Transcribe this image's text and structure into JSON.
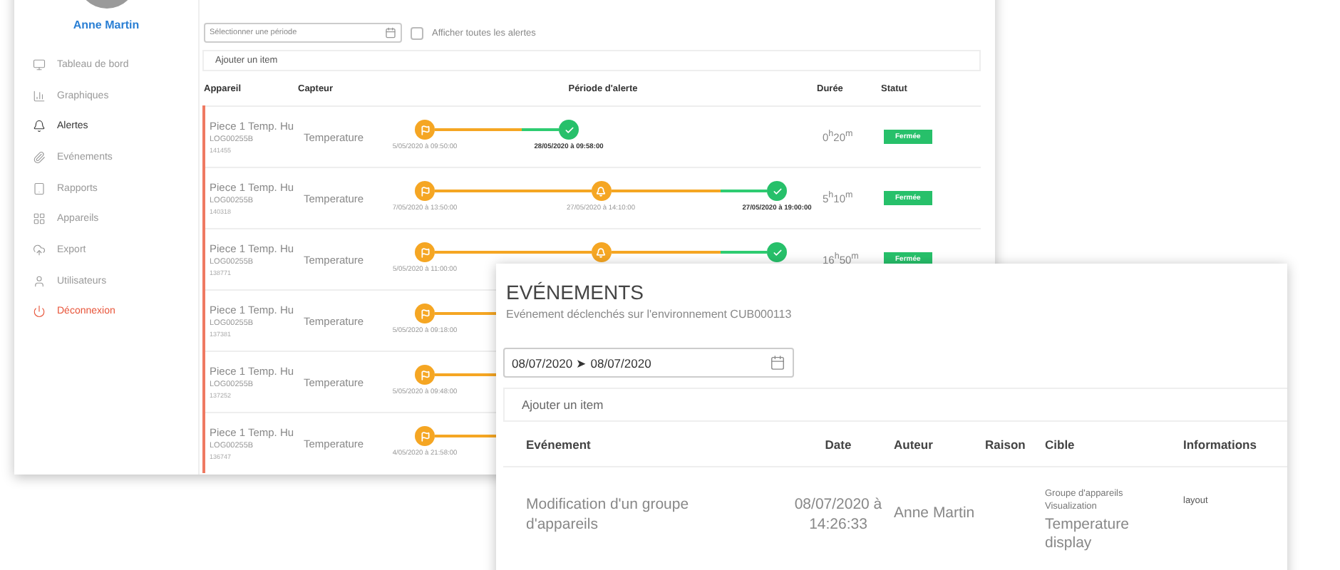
{
  "user": {
    "name": "Anne Martin"
  },
  "sidebar": {
    "items": [
      {
        "label": "Tableau de bord",
        "kind": "link",
        "selected": false
      },
      {
        "label": "Graphiques",
        "kind": "link",
        "selected": false
      },
      {
        "label": "Alertes",
        "kind": "link",
        "selected": true
      },
      {
        "label": "Evénements",
        "kind": "link",
        "selected": false
      },
      {
        "label": "Rapports",
        "kind": "link",
        "selected": false
      },
      {
        "label": "Appareils",
        "kind": "link",
        "selected": false
      },
      {
        "label": "Export",
        "kind": "link",
        "selected": false
      },
      {
        "label": "Utilisateurs",
        "kind": "link",
        "selected": false
      },
      {
        "label": "Déconnexion",
        "kind": "logout",
        "selected": false
      }
    ]
  },
  "alerts": {
    "period_field": {
      "placeholder": "Sélectionner une période"
    },
    "show_all": {
      "label": "Afficher toutes les alertes",
      "checked": false
    },
    "add_item": "Ajouter un item",
    "columns": [
      "Appareil",
      "Capteur",
      "Période d'alerte",
      "Durée",
      "Statut"
    ],
    "rows": [
      {
        "device": "Piece 1 Temp. Hu",
        "logger": "LOG00255B",
        "id": "141455",
        "sensor": "Temperature",
        "events": [
          {
            "kind": "start",
            "time": "5/05/2020 à 09:50:00"
          },
          {
            "kind": "end",
            "time": "28/05/2020 à 09:58:00"
          }
        ],
        "duration": "0$^{h}$20$^{m}$",
        "status": "Fermée"
      },
      {
        "device": "Piece 1 Temp. Hu",
        "logger": "LOG00255B",
        "id": "140318",
        "sensor": "Temperature",
        "events": [
          {
            "kind": "start",
            "time": "7/05/2020 à 13:50:00"
          },
          {
            "kind": "alarm",
            "time": "27/05/2020 à 14:10:00"
          },
          {
            "kind": "end",
            "time": "27/05/2020 à 19:00:00"
          }
        ],
        "duration": "5$^{h}$10$^{m}$",
        "status": "Fermée"
      },
      {
        "device": "Piece 1 Temp. Hu",
        "logger": "LOG00255B",
        "id": "138771",
        "sensor": "Temperature",
        "events": [
          {
            "kind": "start",
            "time": "5/05/2020 à 11:00:00"
          },
          {
            "kind": "alarm"
          },
          {
            "kind": "end"
          }
        ],
        "duration": "16$^{h}$50$^{m}$",
        "status": "Fermée"
      },
      {
        "device": "Piece 1 Temp. Hu",
        "logger": "LOG00255B",
        "id": "137381",
        "sensor": "Temperature",
        "events": [
          {
            "kind": "start",
            "time": "5/05/2020 à 09:18:00"
          }
        ]
      },
      {
        "device": "Piece 1 Temp. Hu",
        "logger": "LOG00255B",
        "id": "137252",
        "sensor": "Temperature",
        "events": [
          {
            "kind": "start",
            "time": "5/05/2020 à 09:48:00"
          }
        ]
      },
      {
        "device": "Piece 1 Temp. Hu",
        "logger": "LOG00255B",
        "id": "136747",
        "sensor": "Temperature",
        "events": [
          {
            "kind": "start",
            "time": "4/05/2020 à 21:58:00"
          }
        ]
      }
    ]
  },
  "events_panel": {
    "title": "EVÉNEMENTS",
    "subtitle": "Evénement déclenchés sur l'environnement CUB000113",
    "date_range": {
      "value": "08/07/2020 ➤ 08/07/2020"
    },
    "add_item": "Ajouter un item",
    "columns": [
      "Evénement",
      "Date",
      "Auteur",
      "Raison",
      "Cible",
      "Informations"
    ],
    "rows": [
      {
        "event": "Modification d'un groupe d'appareils",
        "date": "08/07/2020 à 14:26:33",
        "author": "Anne Martin",
        "target": {
          "type": "Groupe d'appareils",
          "subtype": "Visualization",
          "name": "Temperature display"
        },
        "info": "layout"
      }
    ]
  }
}
